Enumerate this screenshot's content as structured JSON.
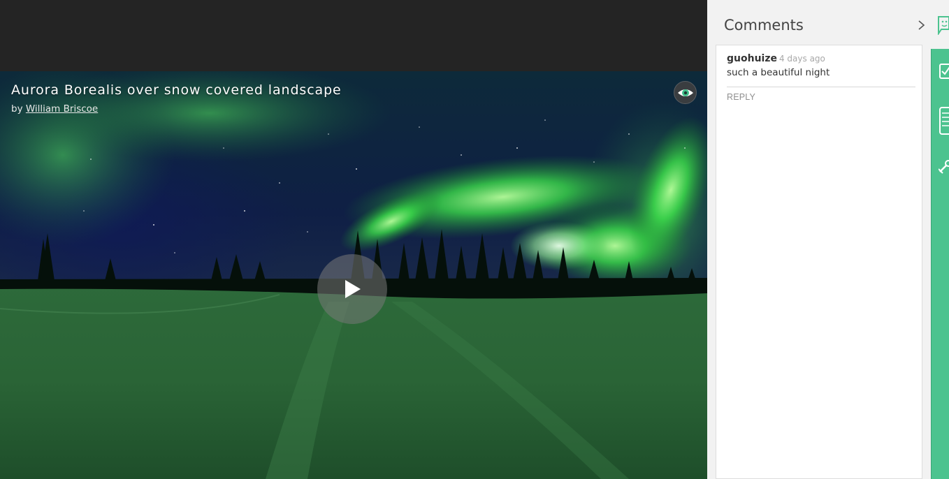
{
  "video": {
    "title": "Aurora Borealis over snow covered landscape",
    "byline_prefix": "by",
    "author": "William Briscoe",
    "icons": {
      "vr_toggle": "eye-icon",
      "play": "play-icon"
    }
  },
  "comments": {
    "header": "Comments",
    "collapse_icon": "chevron-right-icon",
    "items": [
      {
        "user": "guohuize",
        "time": "4 days ago",
        "text": "such a beautiful night",
        "reply_label": "REPLY"
      }
    ]
  },
  "toolbar": {
    "icons": [
      "comment-icon",
      "checkbox-icon",
      "notes-icon",
      "wrench-icon"
    ],
    "accent_color": "#4cc38f"
  }
}
